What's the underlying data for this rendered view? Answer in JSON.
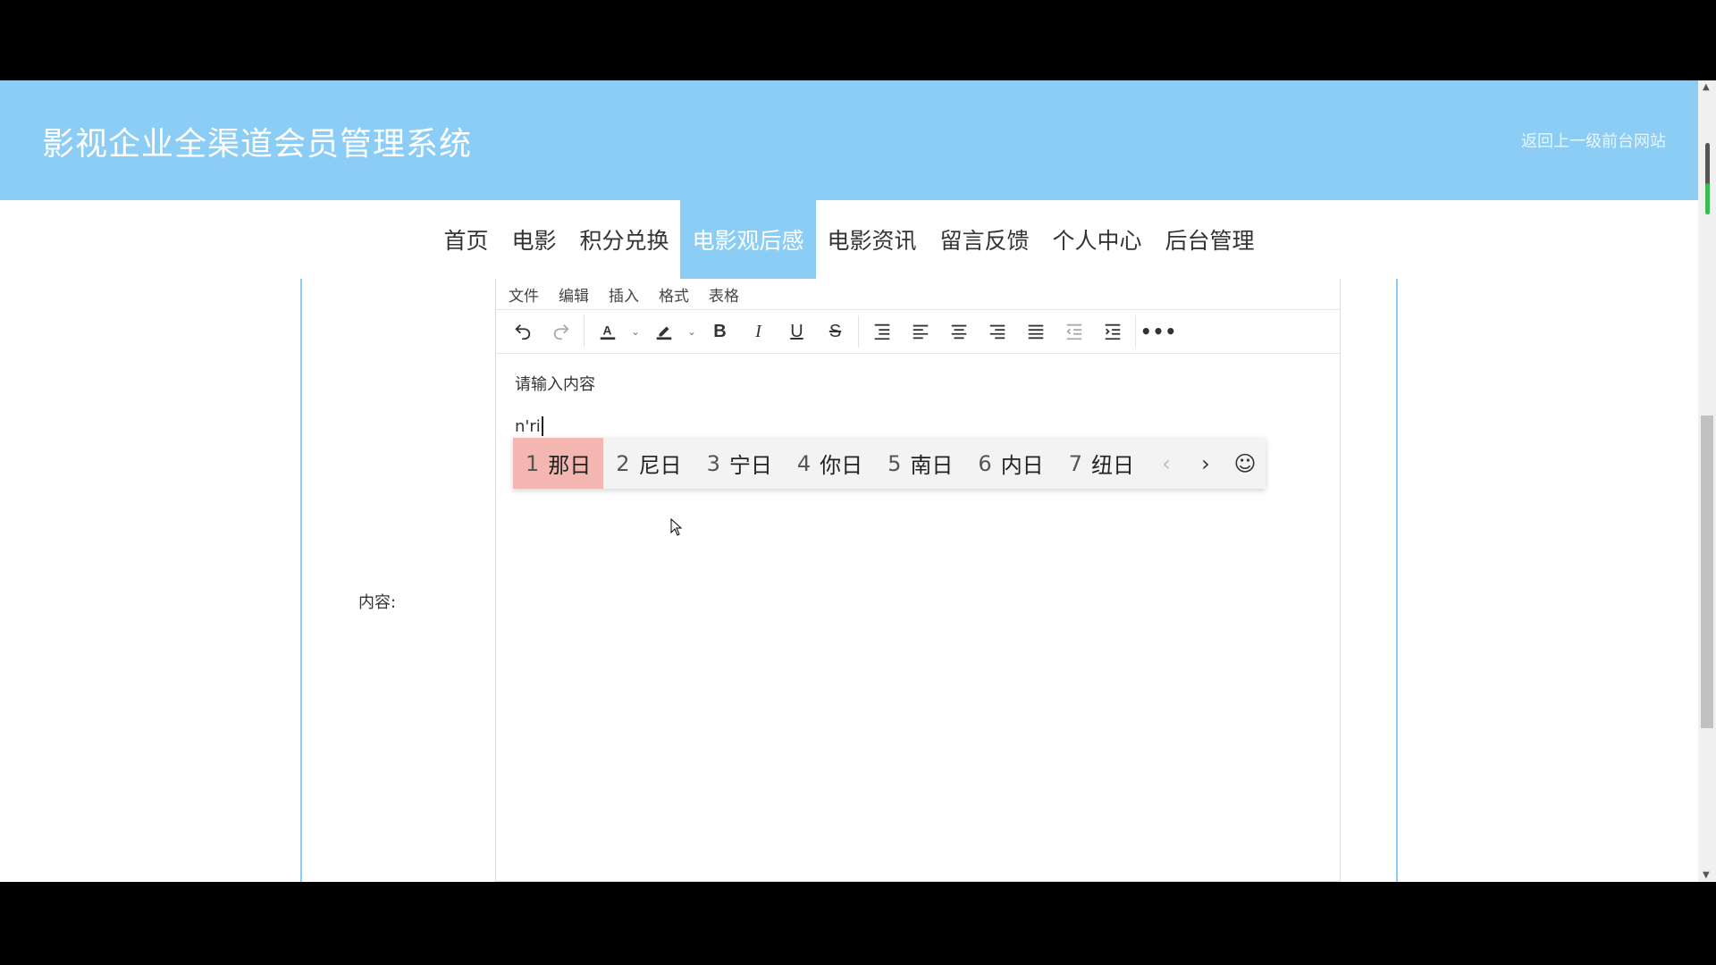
{
  "header": {
    "title": "影视企业全渠道会员管理系统",
    "link": "返回上一级前台网站"
  },
  "nav": {
    "items": [
      "首页",
      "电影",
      "积分兑换",
      "电影观后感",
      "电影资讯",
      "留言反馈",
      "个人中心",
      "后台管理"
    ],
    "active": "电影观后感"
  },
  "form": {
    "content_label": "内容:"
  },
  "editor": {
    "menu": [
      "文件",
      "编辑",
      "插入",
      "格式",
      "表格"
    ],
    "placeholder_text": "请输入内容",
    "typed_text": "n'ri",
    "toolbar_icons": [
      "undo-icon",
      "redo-icon",
      "font-color-icon",
      "highlight-icon",
      "bold-icon",
      "italic-icon",
      "underline-icon",
      "strikethrough-icon",
      "line-height-icon",
      "align-left-icon",
      "align-center-icon",
      "align-right-icon",
      "align-justify-icon",
      "outdent-icon",
      "indent-icon",
      "more-icon"
    ]
  },
  "ime": {
    "candidates": [
      {
        "num": "1",
        "text": "那日"
      },
      {
        "num": "2",
        "text": "尼日"
      },
      {
        "num": "3",
        "text": "宁日"
      },
      {
        "num": "4",
        "text": "你日"
      },
      {
        "num": "5",
        "text": "南日"
      },
      {
        "num": "6",
        "text": "内日"
      },
      {
        "num": "7",
        "text": "纽日"
      }
    ],
    "prev": "‹",
    "next": "›",
    "emoji": "☺",
    "selected_index": 0,
    "highlight_color": "#f4b6b0"
  },
  "colors": {
    "accent": "#8ccdf5"
  }
}
